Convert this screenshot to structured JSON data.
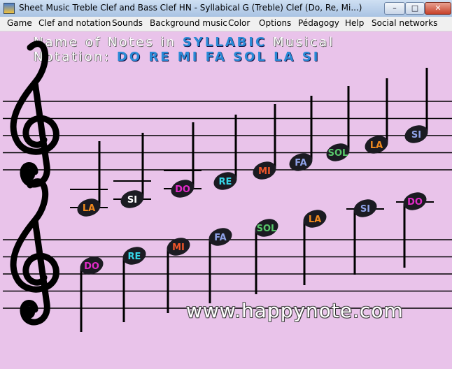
{
  "window": {
    "title": "Sheet Music Treble Clef and Bass Clef HN - Syllabical G (Treble) Clef (Do, Re, Mi...)",
    "title_display": "Sheet Music Treble Clef and Bass Clef HN - Syllabical G (Treble) Clef (Do, Re, Mi...)",
    "minimize_label": "–",
    "maximize_label": "□",
    "close_label": "✕"
  },
  "menu": [
    "Game",
    "Clef and notation",
    "Sounds",
    "Background music",
    "Color",
    "Options",
    "Pédagogy",
    "Help",
    "Social networks"
  ],
  "heading": {
    "line1_prefix": "Name of Notes in ",
    "line1_highlight": "SYLLABIC",
    "line1_suffix": " Musical",
    "line2_prefix": "Notation: ",
    "line2_highlight": "DO RE MI FA SOL LA SI"
  },
  "staff_top": {
    "clef": "treble-clef",
    "notes": [
      {
        "label": "LA",
        "color": "#f08a1e"
      },
      {
        "label": "SI",
        "color": "#ffffff"
      },
      {
        "label": "DO",
        "color": "#e22bc9"
      },
      {
        "label": "RE",
        "color": "#36d6e8"
      },
      {
        "label": "MI",
        "color": "#f0562a"
      },
      {
        "label": "FA",
        "color": "#8fa2e8"
      },
      {
        "label": "SOL",
        "color": "#58c86a"
      },
      {
        "label": "LA",
        "color": "#f08a1e"
      },
      {
        "label": "SI",
        "color": "#8fa2e8"
      }
    ]
  },
  "staff_bottom": {
    "clef": "treble-clef",
    "notes": [
      {
        "label": "DO",
        "color": "#e22bc9"
      },
      {
        "label": "RE",
        "color": "#36d6e8"
      },
      {
        "label": "MI",
        "color": "#f0562a"
      },
      {
        "label": "FA",
        "color": "#8fa2e8"
      },
      {
        "label": "SOL",
        "color": "#58c86a"
      },
      {
        "label": "LA",
        "color": "#f08a1e"
      },
      {
        "label": "SI",
        "color": "#8fa2e8"
      },
      {
        "label": "DO",
        "color": "#e22bc9"
      }
    ]
  },
  "footer_url": "www.happynote.com"
}
